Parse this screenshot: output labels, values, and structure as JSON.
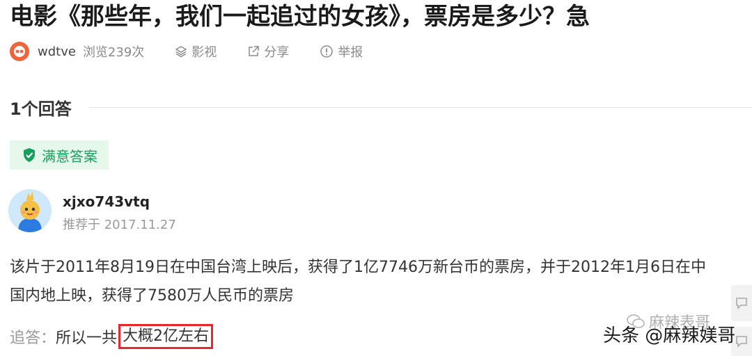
{
  "question": {
    "title": "电影《那些年，我们一起追过的女孩》，票房是多少？急",
    "asker": "wdtve",
    "views": "浏览239次",
    "category": "影视",
    "share": "分享",
    "report": "举报"
  },
  "answers": {
    "count_label": "1个回答",
    "best_label": "满意答案",
    "answerer": "xjxo743vtq",
    "date": "推荐于 2017.11.27",
    "text_line1": "  该片于2011年8月19日在中国台湾上映后，获得了1亿7746万新台币的票房，并于2012年1月6日在中",
    "text_line2": "国内地上映，获得了7580万人民币的票房",
    "followup_label": "追答：",
    "followup_text": "所以一共",
    "followup_highlight": "大概2亿左右"
  },
  "watermark": {
    "main": "头条 @麻辣媄哥",
    "faint": "麻辣表哥"
  },
  "colors": {
    "accent_green": "#17a05d",
    "badge_bg": "#e6f7ec",
    "highlight_border": "#e8262b",
    "avatar_orange": "#f0643c"
  }
}
